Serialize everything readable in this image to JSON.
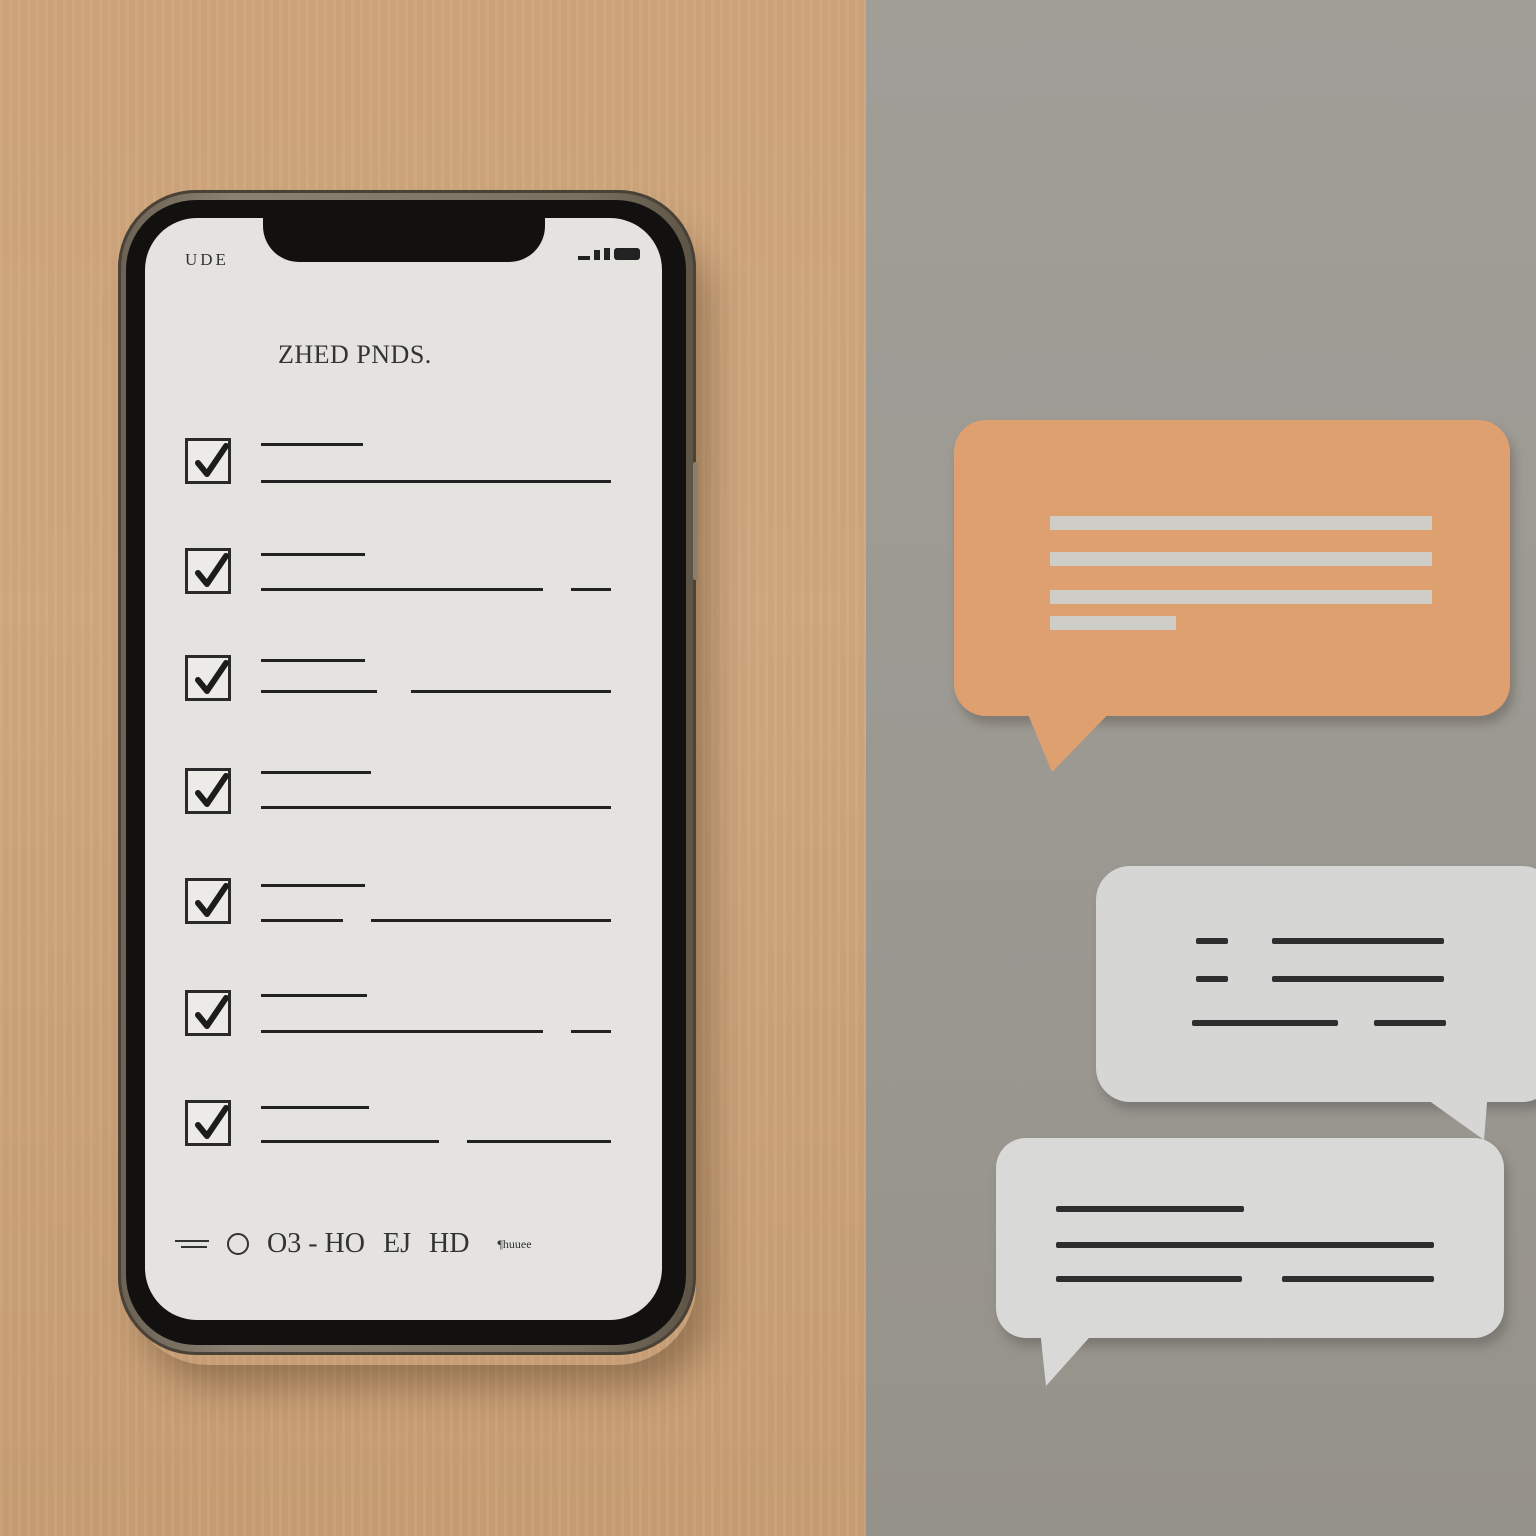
{
  "scene": {
    "wood_color": "#cfa57b",
    "grey_color": "#9d9a94",
    "orange_bubble_color": "#dfa06f",
    "grey_bubble_color": "#d6d6d4"
  },
  "phone": {
    "status_left": "UDE",
    "title": "ZHED PNDS.",
    "tasks": [
      {
        "checked": true
      },
      {
        "checked": true
      },
      {
        "checked": true
      },
      {
        "checked": true
      },
      {
        "checked": true
      },
      {
        "checked": true
      },
      {
        "checked": true
      }
    ],
    "bottom_bar": {
      "text_1": "O3 - HO",
      "text_2": "EJ",
      "text_3": "HD",
      "text_4": "¶huuee"
    }
  },
  "icons": {
    "checkmark": "checkmark-icon",
    "signal": "signal-icon",
    "battery": "battery-icon",
    "alarm": "alarm-icon",
    "menu": "menu-icon"
  }
}
